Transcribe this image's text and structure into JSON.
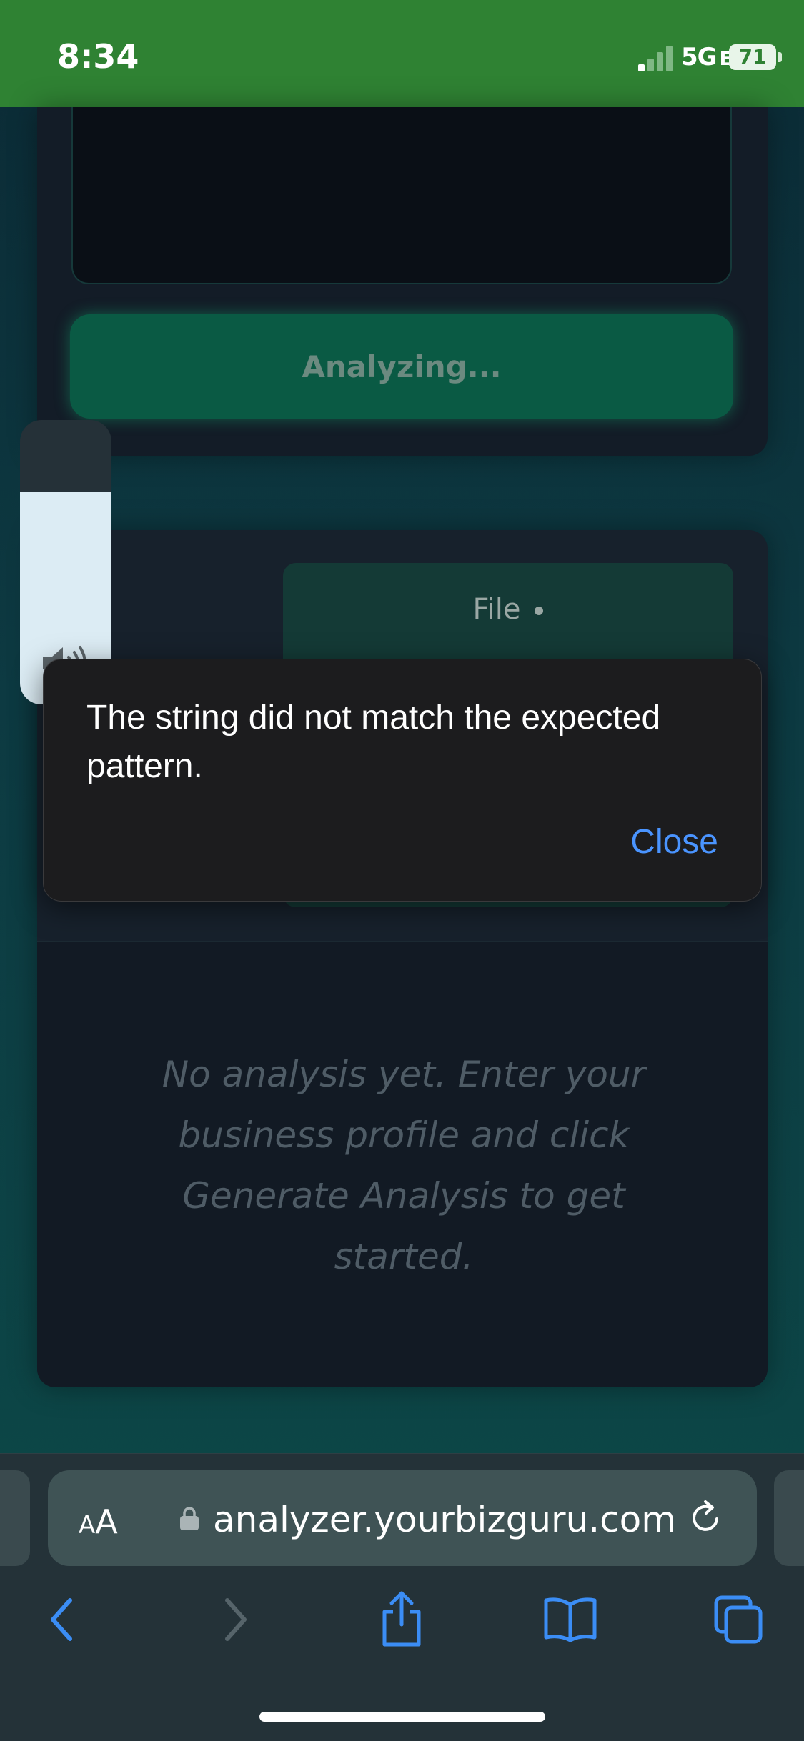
{
  "status_bar": {
    "time": "8:34",
    "network": "5G",
    "network_suffix": "E",
    "battery": "71"
  },
  "analyzer": {
    "analyze_button_label": "Analyzing...",
    "file_tab_label": "File",
    "empty_message": "No analysis yet. Enter your business profile and click Generate Analysis to get started."
  },
  "dialog": {
    "message": "The string did not match the expected pattern.",
    "close_label": "Close"
  },
  "volume": {
    "level": 0.75
  },
  "browser": {
    "text_size_label_small": "A",
    "text_size_label_large": "A",
    "url": "analyzer.yourbizguru.com"
  },
  "icons": {
    "back": "chevron-left-icon",
    "forward": "chevron-right-icon",
    "share": "share-icon",
    "bookmarks": "book-icon",
    "tabs": "tabs-icon",
    "reload": "reload-icon",
    "lock": "lock-icon",
    "speaker": "speaker-icon"
  },
  "colors": {
    "status_bar": "#2f8233",
    "accent_link": "#4a94ff",
    "button_green": "#0a5a44"
  }
}
